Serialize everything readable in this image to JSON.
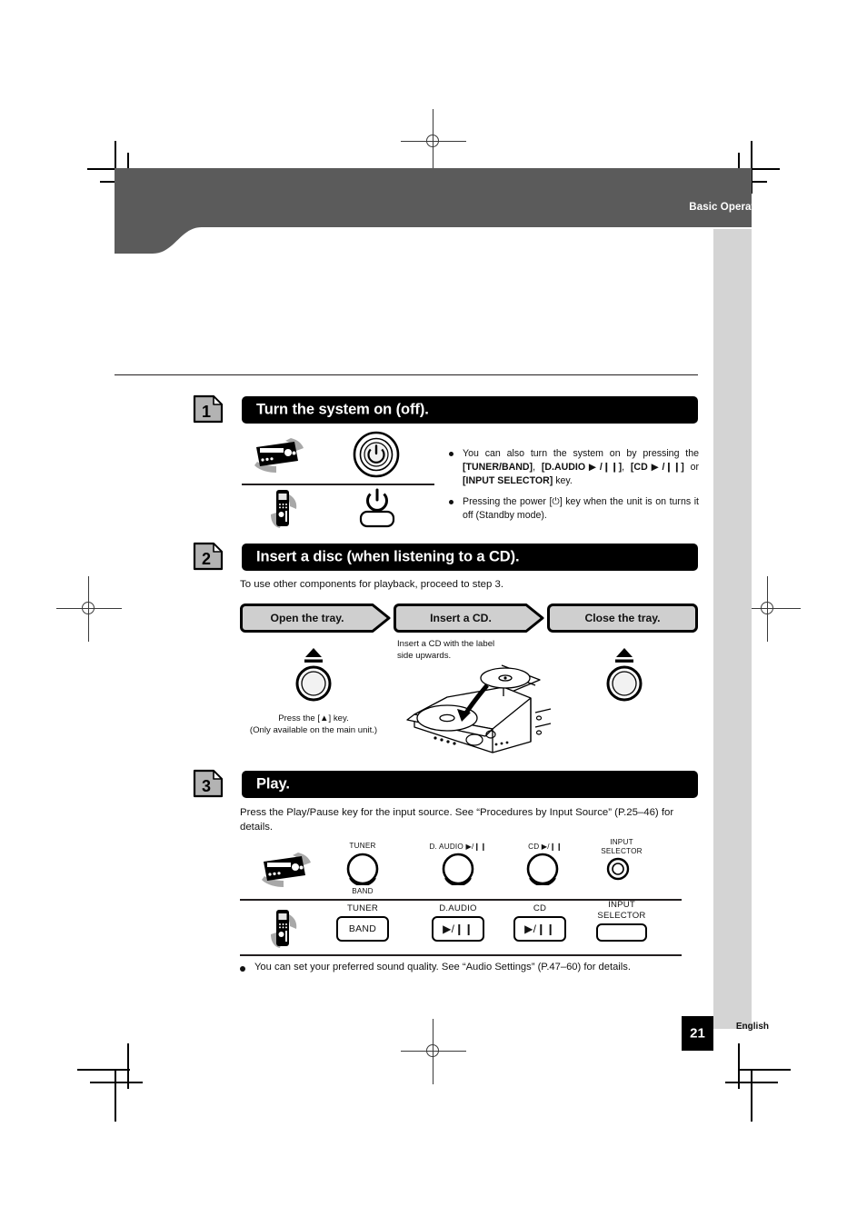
{
  "header": {
    "title": "Basic Operation"
  },
  "steps": [
    {
      "number": "1",
      "title": "Turn the system on (off).",
      "bullets": [
        {
          "lead": "You can also turn the system on by pressing the ",
          "keys": [
            "[TUNER/BAND]",
            "[D.AUDIO▶/❙❙]",
            "[CD▶/❙❙]",
            "[INPUT SELECTOR]"
          ],
          "mid": ", ",
          "orword": " or ",
          "tail": " key."
        },
        {
          "text": "Pressing the power [⏻] key when the unit is on turns it off (Standby mode)."
        }
      ],
      "icons": {
        "unit": "hifi-unit-icon",
        "remote": "remote-control-icon",
        "power_round": "power-button-icon",
        "power_key": "power-key-icon"
      }
    },
    {
      "number": "2",
      "title": "Insert a disc (when listening to a CD).",
      "intro": "To use other components for playback, proceed to step 3.",
      "pills": [
        "Open the tray.",
        "Insert a CD.",
        "Close the tray."
      ],
      "eject_caption": "Press the [▲] key.\n(Only available on the main unit.)",
      "disc_caption": "Insert a CD with the label\nside upwards."
    },
    {
      "number": "3",
      "title": "Play.",
      "intro": "Press the Play/Pause key for the input source. See “Procedures by Input Source” (P.25–46) for details.",
      "main_unit_keys": [
        {
          "top": "TUNER",
          "bottom": "BAND",
          "control": "knob"
        },
        {
          "top": "D. AUDIO ▶/❙❙",
          "bottom": "",
          "control": "knob"
        },
        {
          "top": "CD ▶/❙❙",
          "bottom": "",
          "control": "knob"
        },
        {
          "top": "INPUT\nSELECTOR",
          "bottom": "",
          "control": "small-knob"
        }
      ],
      "remote_keys": [
        {
          "label": "TUNER",
          "key": "BAND"
        },
        {
          "label": "D.AUDIO",
          "key": "▶/❙❙"
        },
        {
          "label": "CD",
          "key": "▶/❙❙"
        },
        {
          "label": "INPUT\nSELECTOR",
          "key": ""
        }
      ]
    }
  ],
  "footnote": "You can set your preferred sound quality. See “Audio Settings” (P.47–60) for details.",
  "footer": {
    "language": "English",
    "page_number": "21"
  },
  "colors": {
    "header_band": "#5b5b5b",
    "sidebar": "#d4d4d4",
    "bar": "#000000",
    "badge": "#b3b3b3"
  }
}
